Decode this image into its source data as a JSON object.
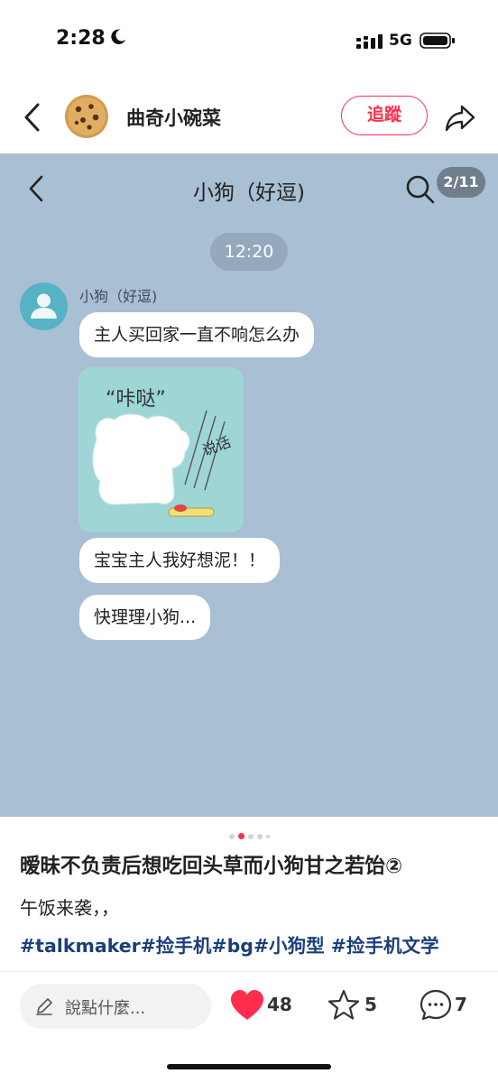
{
  "status_bar": {
    "time": "2:28",
    "network": "5G"
  },
  "header": {
    "author": "曲奇小碗菜",
    "follow_label": "追蹤"
  },
  "chat": {
    "title": "小狗（好逗)",
    "page_indicator": "2/11",
    "timestamp": "12:20",
    "sender": "小狗（好逗)",
    "messages": [
      "主人买回家一直不响怎么办",
      "宝宝主人我好想泥！！",
      "快理理小狗..."
    ],
    "sticker": {
      "caption": "“咔哒”",
      "side_text": "说话"
    }
  },
  "post": {
    "title": "暧昧不负责后想吃回头草而小狗甘之若饴②",
    "body": "午饭来袭，，",
    "hashtags": "#talkmaker#捡手机#bg#小狗型 #捡手机文学"
  },
  "actions": {
    "comment_placeholder": "說點什麼...",
    "likes": "48",
    "stars": "5",
    "comments": "7"
  },
  "colors": {
    "accent": "#ff2e4d",
    "chat_background": "#a9bfd3",
    "hashtag": "#1b3f7a"
  },
  "carousel": {
    "count": 5,
    "active_index": 1
  }
}
